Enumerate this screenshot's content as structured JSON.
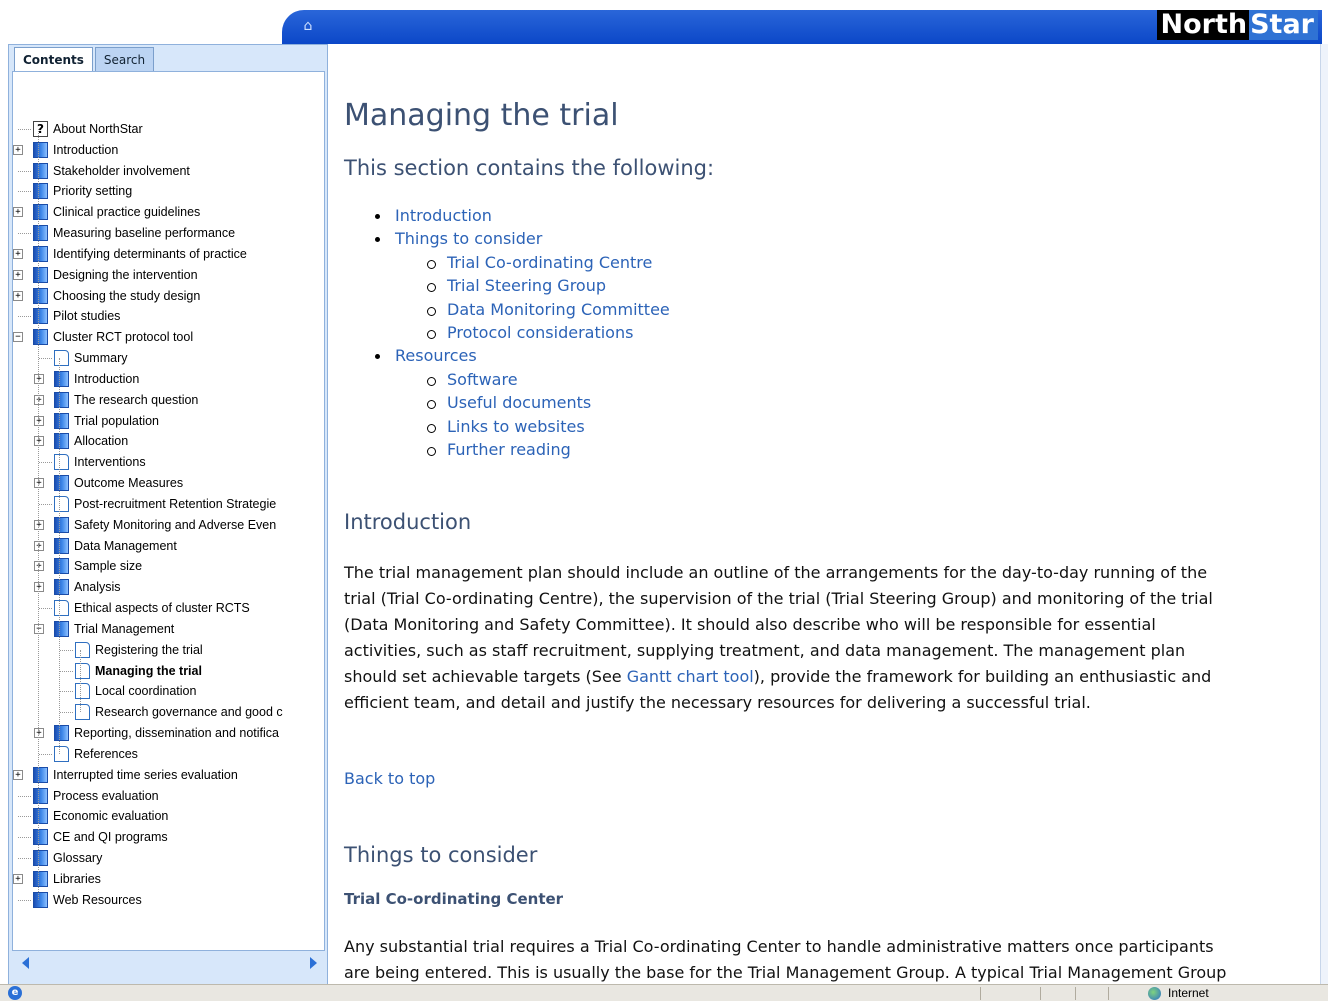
{
  "header": {
    "logo_part1": "North",
    "logo_part2": "Star",
    "home_icon": "home-icon"
  },
  "sidebar": {
    "tabs": [
      {
        "label": "Contents",
        "active": true
      },
      {
        "label": "Search",
        "active": false
      }
    ],
    "tree": [
      {
        "label": "About NorthStar",
        "level": 0,
        "icon": "help",
        "toggle": ""
      },
      {
        "label": "Introduction",
        "level": 0,
        "icon": "book",
        "toggle": "+"
      },
      {
        "label": "Stakeholder involvement",
        "level": 0,
        "icon": "book",
        "toggle": ""
      },
      {
        "label": "Priority setting",
        "level": 0,
        "icon": "book",
        "toggle": ""
      },
      {
        "label": "Clinical practice guidelines",
        "level": 0,
        "icon": "book",
        "toggle": "+"
      },
      {
        "label": "Measuring baseline performance",
        "level": 0,
        "icon": "book",
        "toggle": ""
      },
      {
        "label": "Identifying determinants of practice",
        "level": 0,
        "icon": "book",
        "toggle": "+"
      },
      {
        "label": "Designing the intervention",
        "level": 0,
        "icon": "book",
        "toggle": "+"
      },
      {
        "label": "Choosing the study design",
        "level": 0,
        "icon": "book",
        "toggle": "+"
      },
      {
        "label": "Pilot studies",
        "level": 0,
        "icon": "book",
        "toggle": ""
      },
      {
        "label": "Cluster RCT protocol tool",
        "level": 0,
        "icon": "book",
        "toggle": "-"
      },
      {
        "label": "Summary",
        "level": 1,
        "icon": "page",
        "toggle": ""
      },
      {
        "label": "Introduction",
        "level": 1,
        "icon": "book",
        "toggle": "+"
      },
      {
        "label": "The research question",
        "level": 1,
        "icon": "book",
        "toggle": "+"
      },
      {
        "label": "Trial population",
        "level": 1,
        "icon": "book",
        "toggle": "+"
      },
      {
        "label": "Allocation",
        "level": 1,
        "icon": "book",
        "toggle": "+"
      },
      {
        "label": "Interventions",
        "level": 1,
        "icon": "page",
        "toggle": ""
      },
      {
        "label": "Outcome Measures",
        "level": 1,
        "icon": "book",
        "toggle": "+"
      },
      {
        "label": "Post-recruitment Retention Strategie",
        "level": 1,
        "icon": "page",
        "toggle": ""
      },
      {
        "label": "Safety Monitoring and Adverse Even",
        "level": 1,
        "icon": "book",
        "toggle": "+"
      },
      {
        "label": "Data Management",
        "level": 1,
        "icon": "book",
        "toggle": "+"
      },
      {
        "label": "Sample size",
        "level": 1,
        "icon": "book",
        "toggle": "+"
      },
      {
        "label": "Analysis",
        "level": 1,
        "icon": "book",
        "toggle": "+"
      },
      {
        "label": "Ethical aspects of cluster RCTS",
        "level": 1,
        "icon": "page",
        "toggle": ""
      },
      {
        "label": "Trial Management",
        "level": 1,
        "icon": "book",
        "toggle": "-"
      },
      {
        "label": "Registering the trial",
        "level": 2,
        "icon": "page",
        "toggle": ""
      },
      {
        "label": "Managing the trial",
        "level": 2,
        "icon": "page",
        "toggle": "",
        "selected": true
      },
      {
        "label": "Local coordination",
        "level": 2,
        "icon": "page",
        "toggle": ""
      },
      {
        "label": "Research governance and good c",
        "level": 2,
        "icon": "page",
        "toggle": ""
      },
      {
        "label": "Reporting, dissemination and notifica",
        "level": 1,
        "icon": "book",
        "toggle": "+"
      },
      {
        "label": "References",
        "level": 1,
        "icon": "page",
        "toggle": ""
      },
      {
        "label": "Interrupted time series evaluation",
        "level": 0,
        "icon": "book",
        "toggle": "+"
      },
      {
        "label": "Process evaluation",
        "level": 0,
        "icon": "book",
        "toggle": ""
      },
      {
        "label": "Economic evaluation",
        "level": 0,
        "icon": "book",
        "toggle": ""
      },
      {
        "label": "CE and QI programs",
        "level": 0,
        "icon": "book",
        "toggle": ""
      },
      {
        "label": "Glossary",
        "level": 0,
        "icon": "book",
        "toggle": ""
      },
      {
        "label": "Libraries",
        "level": 0,
        "icon": "book",
        "toggle": "+"
      },
      {
        "label": "Web Resources",
        "level": 0,
        "icon": "book",
        "toggle": ""
      }
    ]
  },
  "main": {
    "title": "Managing the trial",
    "subtitle": "This section contains the following:",
    "toc": {
      "introduction": "Introduction",
      "things": "Things to consider",
      "things_items": [
        "Trial Co-ordinating Centre",
        "Trial Steering Group",
        "Data Monitoring Committee",
        "Protocol considerations"
      ],
      "resources": "Resources",
      "resources_items": [
        "Software",
        "Useful documents",
        "Links to websites",
        "Further reading"
      ]
    },
    "intro_heading": "Introduction",
    "intro_lines": [
      "The trial management plan should include an outline of the arrangements for the day-to-day running of the",
      "trial (Trial Co-ordinating Centre), the supervision of the trial (Trial Steering Group) and monitoring of the trial",
      "(Data Monitoring and Safety Committee).  It should also describe who will be responsible for essential",
      "activities, such as staff recruitment, supplying treatment, and data management.  The management plan",
      "should set achievable targets (See ",
      "efficient team, and detail and justify the necessary resources for delivering a successful trial."
    ],
    "intro_link": "Gantt chart tool",
    "intro_line5_tail": "), provide the framework for building an enthusiastic and",
    "back_to_top": "Back to top",
    "things_heading": "Things to consider",
    "tcc_heading": "Trial Co-ordinating Center",
    "tcc_lines": [
      "Any substantial trial requires a Trial Co-ordinating Center to handle administrative matters once participants",
      "are being entered.  This is usually the base for the Trial Management Group.  A typical Trial Management Group"
    ]
  },
  "status": {
    "zone": "Internet"
  }
}
